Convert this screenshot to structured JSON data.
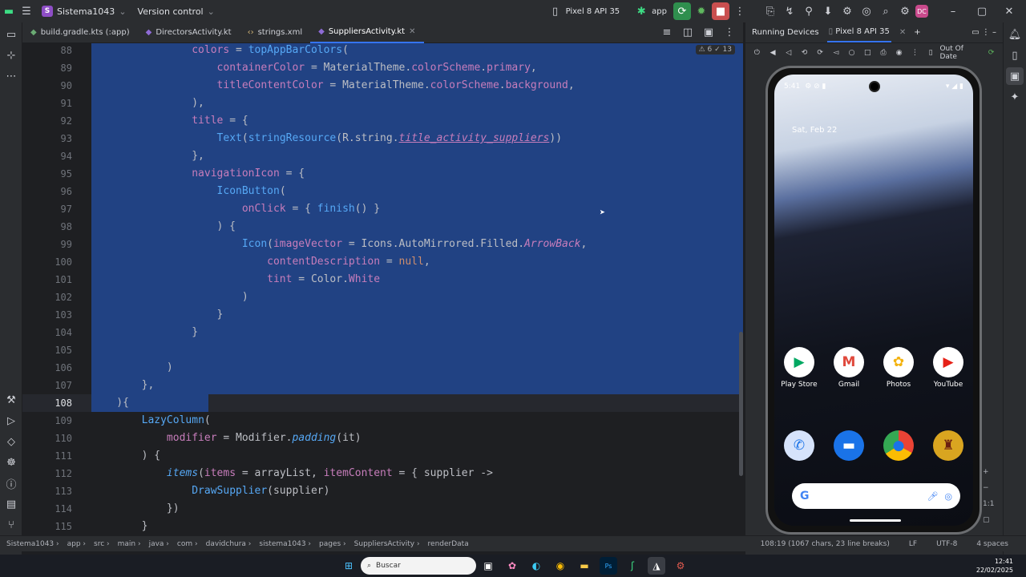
{
  "window": {
    "project": "Sistema1043",
    "project_badge": "S",
    "vcs": "Version control",
    "device": "Pixel 8 API 35",
    "run_config": "app"
  },
  "tabs": [
    {
      "label": "build.gradle.kts (:app)",
      "active": false
    },
    {
      "label": "DirectorsActivity.kt",
      "active": false
    },
    {
      "label": "strings.xml",
      "active": false
    },
    {
      "label": "SuppliersActivity.kt",
      "active": true
    }
  ],
  "editor": {
    "inspection": "⚠ 6  ✓ 13",
    "lines": [
      88,
      89,
      90,
      91,
      92,
      93,
      94,
      95,
      96,
      97,
      98,
      99,
      100,
      101,
      102,
      103,
      104,
      105,
      106,
      107,
      108,
      109,
      110,
      111,
      112,
      113,
      114,
      115
    ]
  },
  "running": {
    "title": "Running Devices",
    "device_tab": "Pixel 8 API 35",
    "status": "Out Of Date"
  },
  "phone": {
    "time": "5:41",
    "date": "Sat, Feb 22",
    "apps_row1": [
      "Play Store",
      "Gmail",
      "Photos",
      "YouTube"
    ],
    "search_letter": "G"
  },
  "breadcrumb": [
    "Sistema1043",
    "app",
    "src",
    "main",
    "java",
    "com",
    "davidchura",
    "sistema1043",
    "pages",
    "SuppliersActivity",
    "renderData"
  ],
  "status": {
    "position": "108:19 (1067 chars, 23 line breaks)",
    "line_sep": "LF",
    "encoding": "UTF-8",
    "indent": "4 spaces"
  },
  "taskbar": {
    "search": "Buscar",
    "time": "12:41",
    "date": "22/02/2025"
  },
  "colors": {
    "selection": "#214283",
    "accent": "#3574f0"
  }
}
